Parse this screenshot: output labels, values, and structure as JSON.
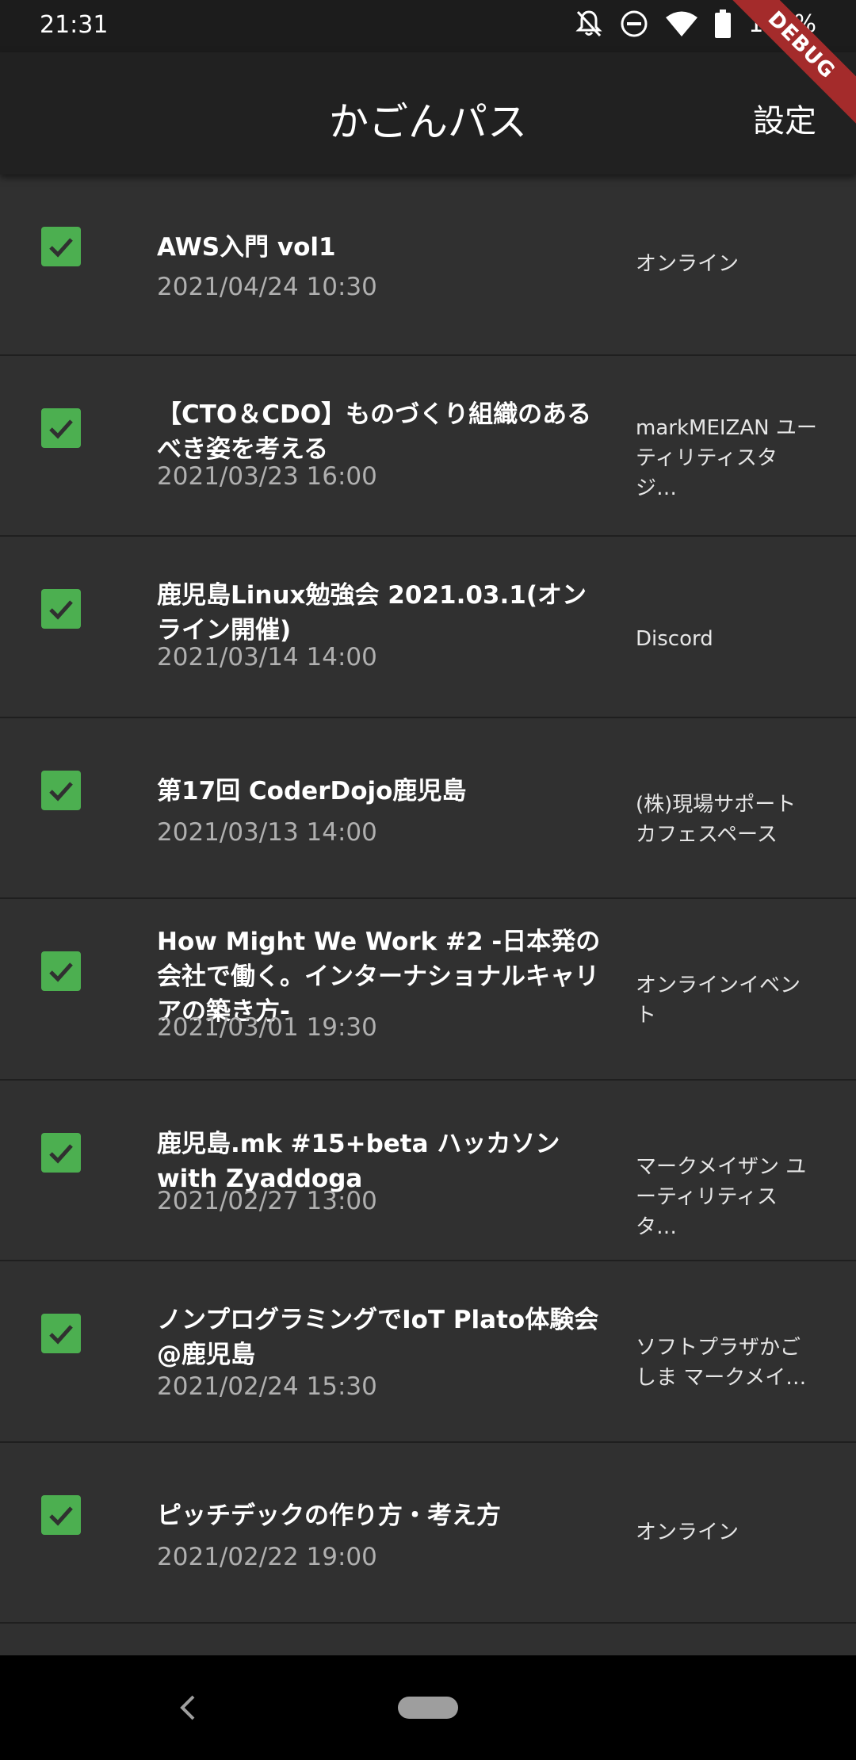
{
  "status_bar": {
    "time": "21:31",
    "battery": "100%",
    "icons": [
      "notifications-off-icon",
      "do-not-disturb-icon",
      "wifi-icon",
      "battery-icon"
    ]
  },
  "debug_banner": "DEBUG",
  "app_bar": {
    "title": "かごんパス",
    "settings_label": "設定"
  },
  "colors": {
    "checkbox": "#4caf50",
    "background": "#303030",
    "app_bar": "#212121",
    "debug_banner": "#a42b2b"
  },
  "events": [
    {
      "title": "AWS入門 vol1",
      "date": "2021/04/24 10:30",
      "venue": "オンライン",
      "checked": true
    },
    {
      "title": "【CTO＆CDO】ものづくり組織のあるべき姿を考える",
      "date": "2021/03/23 16:00",
      "venue": "markMEIZAN ユーティリティスタジ…",
      "checked": true
    },
    {
      "title": "鹿児島Linux勉強会 2021.03.1(オンライン開催)",
      "date": "2021/03/14 14:00",
      "venue": "Discord",
      "checked": true
    },
    {
      "title": "第17回 CoderDojo鹿児島",
      "date": "2021/03/13 14:00",
      "venue": "(株)現場サポート カフェスペース",
      "checked": true
    },
    {
      "title": "How Might We Work #2 -日本発の会社で働く。インターナショナルキャリアの築き方-",
      "date": "2021/03/01 19:30",
      "venue": "オンラインイベント",
      "checked": true
    },
    {
      "title": "鹿児島.mk #15+beta ハッカソン with Zyaddoga",
      "date": "2021/02/27 13:00",
      "venue": "マークメイザン ユーティリティスタ…",
      "checked": true
    },
    {
      "title": "ノンプログラミングでIoT Plato体験会@鹿児島",
      "date": "2021/02/24 15:30",
      "venue": "ソフトプラザかごしま マークメイ…",
      "checked": true
    },
    {
      "title": "ピッチデックの作り方・考え方",
      "date": "2021/02/22 19:00",
      "venue": "オンライン",
      "checked": true
    }
  ],
  "nav_bar": {
    "icons": [
      "back-icon",
      "home-pill"
    ]
  }
}
